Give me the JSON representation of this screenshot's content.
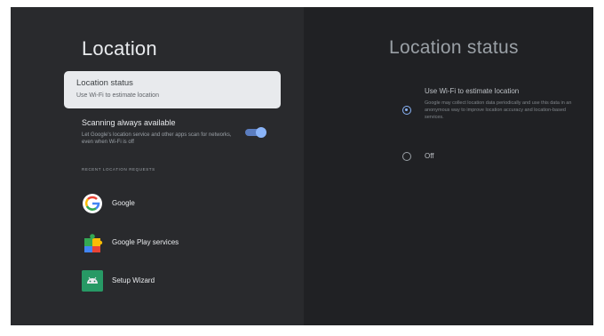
{
  "left": {
    "title": "Location",
    "status_card": {
      "title": "Location status",
      "subtitle": "Use Wi-Fi to estimate location"
    },
    "scanning": {
      "title": "Scanning always available",
      "description": "Let Google's location service and other apps scan for networks, even when Wi-Fi is off",
      "toggle_on": true
    },
    "section_label": "RECENT LOCATION REQUESTS",
    "apps": [
      {
        "label": "Google",
        "icon": "google-g-icon"
      },
      {
        "label": "Google Play services",
        "icon": "play-services-puzzle-icon"
      },
      {
        "label": "Setup Wizard",
        "icon": "android-robot-icon"
      }
    ]
  },
  "right": {
    "title": "Location status",
    "options": [
      {
        "title": "Use Wi-Fi to estimate location",
        "description": "Google may collect location data periodically and use this data in an anonymous way to improve location accuracy and location-based services.",
        "selected": true
      },
      {
        "title": "Off",
        "description": "",
        "selected": false
      }
    ]
  },
  "colors": {
    "accent": "#8ab4f8",
    "background": "#202124",
    "panel": "#292a2d"
  }
}
